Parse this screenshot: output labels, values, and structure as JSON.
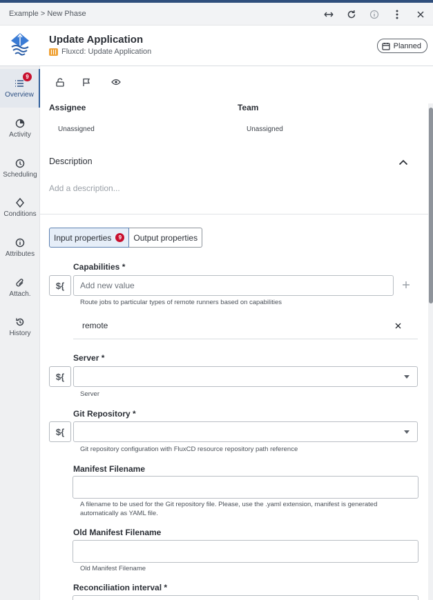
{
  "breadcrumb": "Example > New Phase",
  "header": {
    "title": "Update Application",
    "subtitle": "Fluxcd: Update Application",
    "status": "Planned"
  },
  "sidebar": {
    "items": [
      {
        "label": "Overview",
        "badge": "9",
        "icon": "list-icon"
      },
      {
        "label": "Activity",
        "icon": "pie-icon"
      },
      {
        "label": "Scheduling",
        "icon": "clock-icon"
      },
      {
        "label": "Conditions",
        "icon": "diamond-icon"
      },
      {
        "label": "Attributes",
        "icon": "info-icon"
      },
      {
        "label": "Attach.",
        "icon": "paperclip-icon"
      },
      {
        "label": "History",
        "icon": "history-icon"
      }
    ]
  },
  "overview": {
    "assignee_label": "Assignee",
    "assignee_value": "Unassigned",
    "team_label": "Team",
    "team_value": "Unassigned",
    "description_label": "Description",
    "description_placeholder": "Add a description..."
  },
  "tabs": {
    "input_label": "Input properties",
    "input_count": "9",
    "output_label": "Output properties"
  },
  "fields": {
    "capabilities": {
      "label": "Capabilities *",
      "placeholder": "Add new value",
      "hint": "Route jobs to particular types of remote runners based on capabilities",
      "values": [
        "remote"
      ]
    },
    "server": {
      "label": "Server *",
      "hint": "Server"
    },
    "git_repository": {
      "label": "Git Repository *",
      "hint": "Git repository configuration with FluxCD resource repository path reference"
    },
    "manifest_filename": {
      "label": "Manifest Filename",
      "hint": "A filename to be used for the Git repository file. Please, use the .yaml extension, manifest is generated automatically as YAML file."
    },
    "old_manifest_filename": {
      "label": "Old Manifest Filename",
      "hint": "Old Manifest Filename"
    },
    "reconciliation_interval": {
      "label": "Reconciliation interval *"
    }
  },
  "var_button_label": "${",
  "colors": {
    "accent": "#2f5d9a",
    "badge": "#c8102e",
    "phase_icon": "#f0a43a"
  }
}
